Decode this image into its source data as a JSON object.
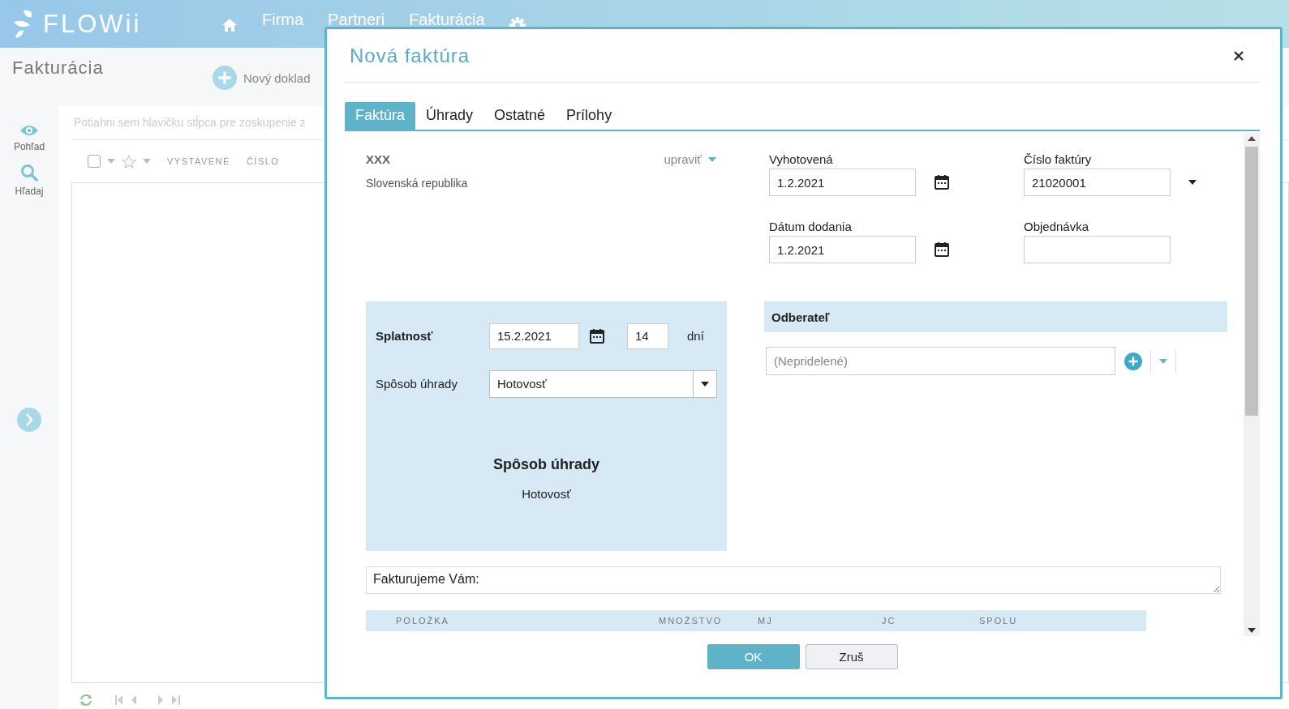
{
  "app": {
    "logo": "FLOWii",
    "nav": [
      {
        "kind": "home"
      },
      {
        "kind": "text",
        "label": "Firma"
      },
      {
        "kind": "text",
        "label": "Partneri"
      },
      {
        "kind": "text",
        "label": "Fakturácia"
      },
      {
        "kind": "settings"
      }
    ]
  },
  "sidebar": {
    "items": [
      {
        "kind": "view",
        "label": "Pohľad"
      },
      {
        "kind": "search",
        "label": "Hľadaj"
      }
    ]
  },
  "page": {
    "title": "Fakturácia",
    "new_button": "Nový doklad",
    "group_hint": "Potiahni sem hlavičku stĺpca pre zoskupenie z",
    "select_all": {
      "checked": false
    },
    "columns": [
      "VYSTAVENÉ",
      "ČÍSLO"
    ]
  },
  "dialog": {
    "title": "Nová faktúra",
    "tabs": [
      {
        "label": "Faktúra",
        "selected": true
      },
      {
        "label": "Úhrady",
        "selected": false
      },
      {
        "label": "Ostatné",
        "selected": false
      },
      {
        "label": "Prílohy",
        "selected": false
      }
    ],
    "supplier": {
      "name": "XXX",
      "country": "Slovenská republika",
      "edit": "upraviť"
    },
    "fields": [
      {
        "kind": "date",
        "label": "Vyhotovená",
        "value": "1.2.2021"
      },
      {
        "kind": "dropdown",
        "label": "Číslo faktúry",
        "value": "21020001"
      },
      {
        "kind": "date",
        "label": "Dátum dodania",
        "value": "1.2.2021"
      },
      {
        "kind": "text",
        "label": "Objednávka"
      }
    ],
    "payment": {
      "due_label": "Splatnosť",
      "due_date": "15.2.2021",
      "days": "14",
      "days_unit": "dní",
      "method_label": "Spôsob úhrady",
      "method": "Hotovosť",
      "summary_title": "Spôsob úhrady",
      "summary_value": "Hotovosť"
    },
    "customer": {
      "title": "Odberateľ",
      "placeholder": "(Nepridelené)"
    },
    "intro": "Fakturujeme Vám:",
    "items_columns": [
      "POLOŽKA",
      "MNOŽSTVO",
      "MJ",
      "JC",
      "SPOLU"
    ],
    "buttons": [
      {
        "kind": "primary",
        "label": "OK"
      },
      {
        "kind": "secondary",
        "label": "Zruš"
      }
    ]
  }
}
